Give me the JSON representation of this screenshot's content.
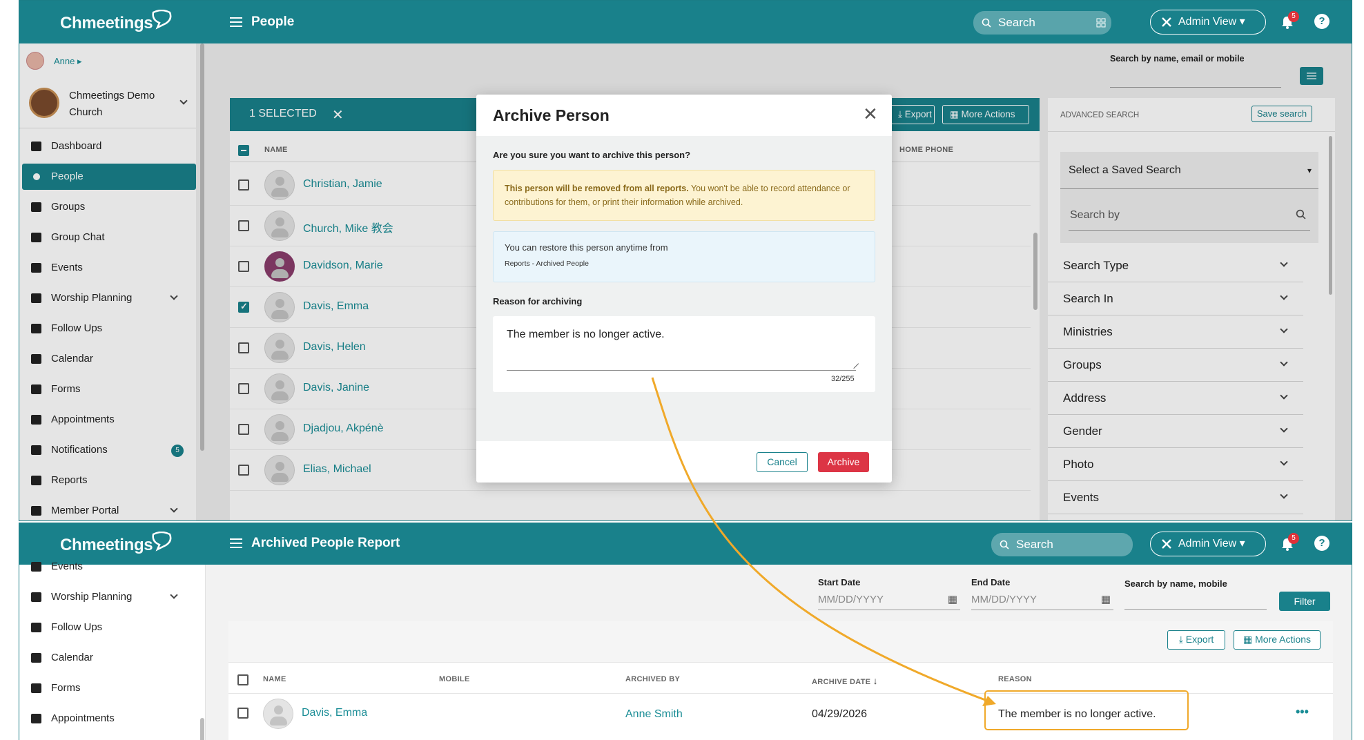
{
  "top": {
    "logo": "Chmeetings",
    "page_title": "People",
    "search_placeholder": "Search",
    "admin_view": "Admin View",
    "notif_count": "5",
    "help": "?",
    "user_name": "Anne",
    "church_name": "Chmeetings Demo Church",
    "sidebar": [
      {
        "label": "Dashboard",
        "icon": "chart-line-icon"
      },
      {
        "label": "People",
        "icon": "person-icon",
        "active": true
      },
      {
        "label": "Groups",
        "icon": "users-icon"
      },
      {
        "label": "Group Chat",
        "icon": "chat-icon"
      },
      {
        "label": "Events",
        "icon": "calendar-icon"
      },
      {
        "label": "Worship Planning",
        "icon": "music-icon",
        "expandable": true
      },
      {
        "label": "Follow Ups",
        "icon": "handshake-icon"
      },
      {
        "label": "Calendar",
        "icon": "calendar-grid-icon"
      },
      {
        "label": "Forms",
        "icon": "form-icon"
      },
      {
        "label": "Appointments",
        "icon": "clock-icon"
      },
      {
        "label": "Notifications",
        "icon": "bell-icon",
        "badge": "5"
      },
      {
        "label": "Reports",
        "icon": "report-icon"
      },
      {
        "label": "Member Portal",
        "icon": "mobile-icon",
        "expandable": true
      }
    ],
    "search_label": "Search by name, email or mobile",
    "selected_label": "1 SELECTED",
    "export_label": "Export",
    "more_actions_label": "More Actions",
    "col_name": "NAME",
    "col_home_phone": "HOME PHONE",
    "people": [
      {
        "name": "Christian, Jamie",
        "checked": false
      },
      {
        "name": "Church, Mike 教会",
        "checked": false
      },
      {
        "name": "Davidson, Marie",
        "checked": false,
        "photo": true
      },
      {
        "name": "Davis, Emma",
        "checked": true
      },
      {
        "name": "Davis, Helen",
        "checked": false
      },
      {
        "name": "Davis, Janine",
        "checked": false
      },
      {
        "name": "Djadjou, Akpénè",
        "checked": false
      },
      {
        "name": "Elias, Michael",
        "checked": false
      }
    ],
    "advanced": {
      "title": "ADVANCED SEARCH",
      "save_label": "Save search",
      "saved_search": "Select a Saved Search",
      "search_by": "Search by",
      "sections": [
        "Search Type",
        "Search In",
        "Ministries",
        "Groups",
        "Address",
        "Gender",
        "Photo",
        "Events"
      ]
    }
  },
  "modal": {
    "title": "Archive Person",
    "question": "Are you sure you want to archive this person?",
    "warning_bold": "This person will be removed from all reports.",
    "warning_text": " You won't be able to record attendance or contributions for them, or print their information while archived.",
    "info_text": "You can restore this person anytime from",
    "info_path": "Reports - Archived People",
    "reason_label": "Reason for archiving",
    "reason_value": "The member is no longer active.",
    "char_count": "32/255",
    "cancel": "Cancel",
    "archive": "Archive"
  },
  "bottom": {
    "logo": "Chmeetings",
    "page_title": "Archived People Report",
    "search_placeholder": "Search",
    "admin_view": "Admin View",
    "notif_count": "5",
    "sidebar": [
      {
        "label": "Events",
        "icon": "calendar-icon"
      },
      {
        "label": "Worship Planning",
        "icon": "music-icon",
        "expandable": true
      },
      {
        "label": "Follow Ups",
        "icon": "handshake-icon"
      },
      {
        "label": "Calendar",
        "icon": "calendar-grid-icon"
      },
      {
        "label": "Forms",
        "icon": "form-icon"
      },
      {
        "label": "Appointments",
        "icon": "clock-icon"
      }
    ],
    "start_date_label": "Start Date",
    "end_date_label": "End Date",
    "date_placeholder": "MM/DD/YYYY",
    "search_label": "Search by name, mobile",
    "filter": "Filter",
    "export_label": "Export",
    "more_actions_label": "More Actions",
    "columns": [
      "NAME",
      "MOBILE",
      "ARCHIVED BY",
      "ARCHIVE DATE",
      "REASON"
    ],
    "row": {
      "name": "Davis, Emma",
      "archived_by": "Anne Smith",
      "archive_date": "04/29/2026",
      "reason": "The member is no longer active.",
      "more": "•••"
    }
  },
  "colors": {
    "brand": "#19818b",
    "danger": "#dc3545",
    "highlight": "#f0a92a"
  }
}
